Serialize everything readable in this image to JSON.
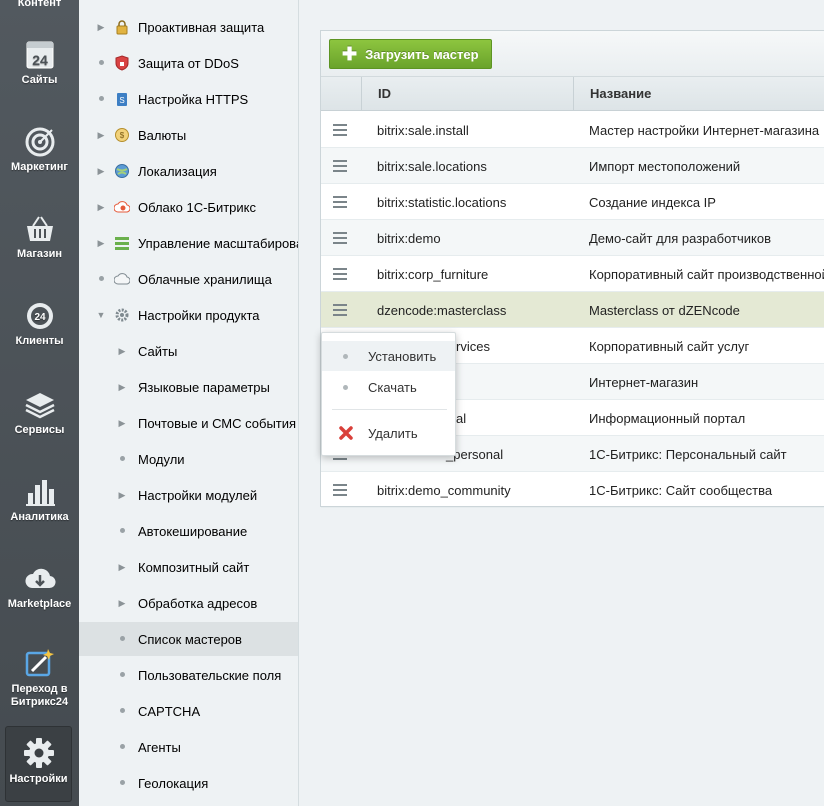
{
  "left_panel": {
    "top_label": "Контент",
    "items": [
      {
        "label": "Сайты",
        "icon": "sites-icon"
      },
      {
        "label": "Маркетинг",
        "icon": "target-icon"
      },
      {
        "label": "Магазин",
        "icon": "basket-icon"
      },
      {
        "label": "Клиенты",
        "icon": "clients-24-icon"
      },
      {
        "label": "Сервисы",
        "icon": "layers-icon"
      },
      {
        "label": "Аналитика",
        "icon": "analytics-icon"
      },
      {
        "label": "Marketplace",
        "icon": "cloud-download-icon"
      },
      {
        "label_line1": "Переход в",
        "label_line2": "Битрикс24",
        "icon": "magic-wand-icon"
      },
      {
        "label": "Настройки",
        "icon": "gear-icon",
        "active": true
      }
    ]
  },
  "tree": {
    "items": [
      {
        "label": "Проактивная защита",
        "marker": "arrow",
        "icon": "lock-icon"
      },
      {
        "label": "Защита от DDoS",
        "marker": "dot",
        "icon": "shield-icon"
      },
      {
        "label": "Настройка HTTPS",
        "marker": "dot",
        "icon": "https-icon"
      },
      {
        "label": "Валюты",
        "marker": "arrow",
        "icon": "currency-icon"
      },
      {
        "label": "Локализация",
        "marker": "arrow",
        "icon": "globe-icon"
      },
      {
        "label": "Облако 1С-Битрикс",
        "marker": "arrow",
        "icon": "cloud-bitrix-icon"
      },
      {
        "label": "Управление масштабирова",
        "marker": "arrow",
        "icon": "scale-icon"
      },
      {
        "label": "Облачные хранилища",
        "marker": "dot",
        "icon": "cloud-storage-icon"
      },
      {
        "label": "Настройки продукта",
        "marker": "open",
        "icon": "gear-small-icon"
      },
      {
        "label": "Сайты",
        "marker": "arrow",
        "sub": true
      },
      {
        "label": "Языковые параметры",
        "marker": "arrow",
        "sub": true
      },
      {
        "label": "Почтовые и СМС события",
        "marker": "arrow",
        "sub": true
      },
      {
        "label": "Модули",
        "marker": "dot",
        "sub": true
      },
      {
        "label": "Настройки модулей",
        "marker": "arrow",
        "sub": true
      },
      {
        "label": "Автокеширование",
        "marker": "dot",
        "sub": true
      },
      {
        "label": "Композитный сайт",
        "marker": "arrow",
        "sub": true
      },
      {
        "label": "Обработка адресов",
        "marker": "arrow",
        "sub": true
      },
      {
        "label": "Список мастеров",
        "marker": "dot",
        "sub": true,
        "selected": true
      },
      {
        "label": "Пользовательские поля",
        "marker": "dot",
        "sub": true
      },
      {
        "label": "CAPTCHA",
        "marker": "dot",
        "sub": true
      },
      {
        "label": "Агенты",
        "marker": "dot",
        "sub": true
      },
      {
        "label": "Геолокация",
        "marker": "dot",
        "sub": true
      }
    ]
  },
  "toolbar": {
    "upload_label": "Загрузить мастер"
  },
  "table": {
    "columns": {
      "id": "ID",
      "name": "Название"
    },
    "rows": [
      {
        "id": "bitrix:sale.install",
        "name": "Мастер настройки Интернет-магазина"
      },
      {
        "id": "bitrix:sale.locations",
        "name": "Импорт местоположений"
      },
      {
        "id": "bitrix:statistic.locations",
        "name": "Создание индекса IP"
      },
      {
        "id": "bitrix:demo",
        "name": "Демо-сайт для разработчиков"
      },
      {
        "id": "bitrix:corp_furniture",
        "name": "Корпоративный сайт производственной"
      },
      {
        "id": "dzencode:masterclass",
        "name": "Masterclass от dZENcode",
        "highlighted": true
      },
      {
        "id": "rvices",
        "name": "Корпоративный сайт услуг"
      },
      {
        "id": "",
        "name": "Интернет-магазин"
      },
      {
        "id": "al",
        "name": "Информационный портал"
      },
      {
        "id": "_personal",
        "name": "1С-Битрикс: Персональный сайт"
      },
      {
        "id": "bitrix:demo_community",
        "name": "1С-Битрикс: Сайт сообщества"
      }
    ]
  },
  "context_menu": {
    "install": "Установить",
    "download": "Скачать",
    "delete": "Удалить"
  },
  "colors": {
    "accent_green": "#7ab535",
    "panel_dark": "#4c5257",
    "highlight_row": "#e4e9d4",
    "delete_red": "#d9403a"
  }
}
